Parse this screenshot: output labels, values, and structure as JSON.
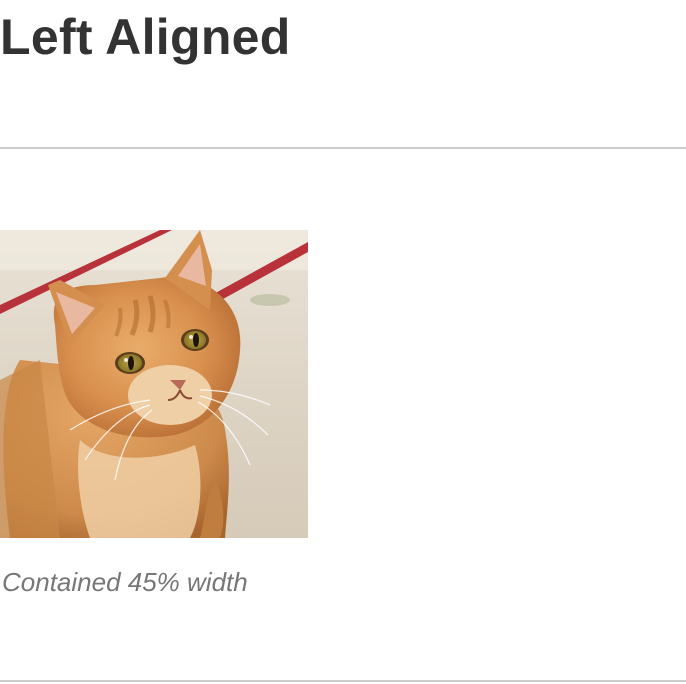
{
  "section": {
    "heading": "Left Aligned"
  },
  "figure": {
    "image_subject": "orange-tabby-cat-photo",
    "caption": "Contained 45% width"
  },
  "colors": {
    "heading": "#333333",
    "caption": "#777777",
    "divider": "#cccccc",
    "background": "#ffffff"
  }
}
